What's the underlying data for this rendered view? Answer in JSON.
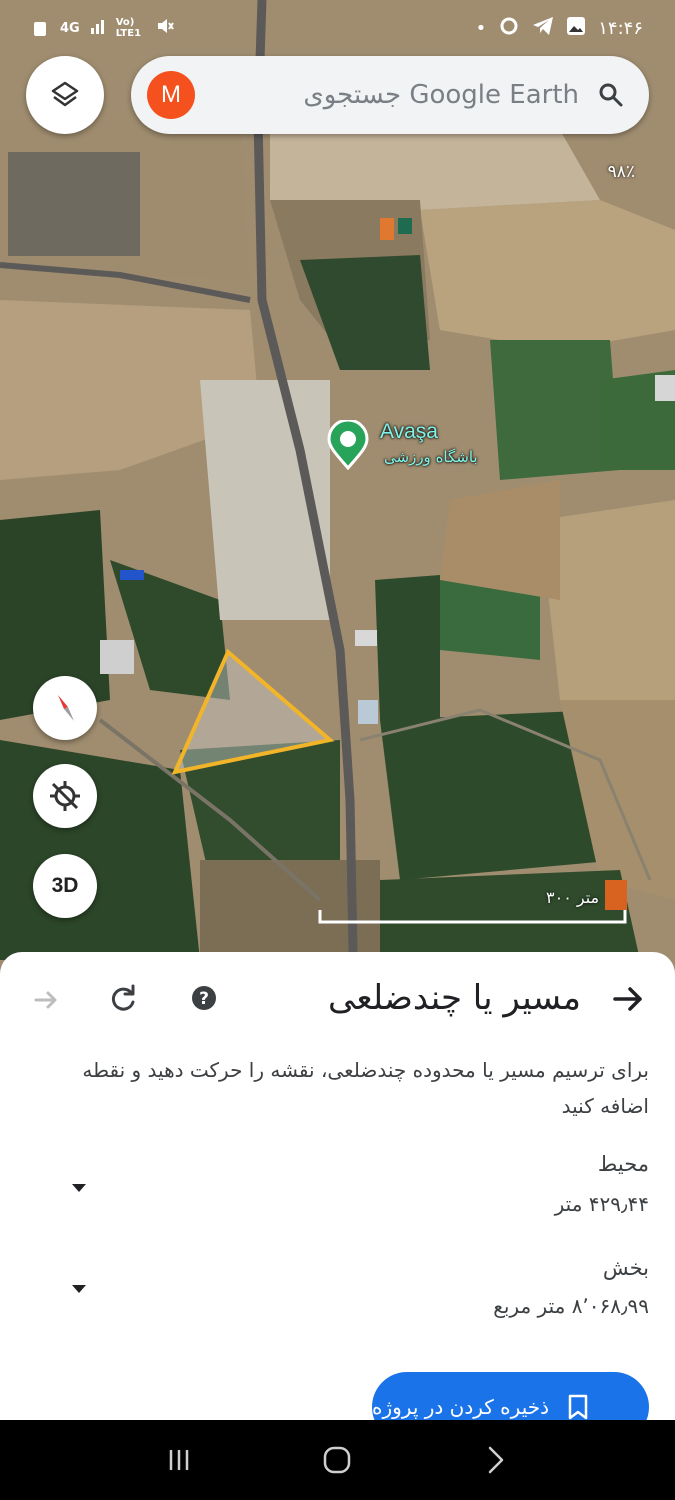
{
  "status_bar": {
    "time": "۱۴:۴۶",
    "network_left": "4G",
    "network_volte": "Vo) LTE1"
  },
  "search": {
    "placeholder": "جستجوی Google Earth",
    "avatar_letter": "M"
  },
  "map": {
    "percent_label": "۹۸٪",
    "place_name": "Avaşa",
    "place_subtitle": "باشگاه ورزشی",
    "scale_label": "۳۰۰ متر",
    "button_3d": "3D",
    "polygon_color": "#f2b428",
    "pin_color": "#27a35a"
  },
  "sheet": {
    "title": "مسیر یا چندضلعی",
    "description": "برای ترسیم مسیر یا محدوده چندضلعی، نقشه را حرکت دهید و نقطه اضافه کنید",
    "perimeter_label": "محیط",
    "perimeter_value": "۴۲۹٫۴۴ متر",
    "area_label": "بخش",
    "area_value": "۸٬۰۶۸٫۹۹ متر مربع",
    "save_label": "ذخیره کردن در پروژه",
    "accent": "#1a73e8"
  }
}
